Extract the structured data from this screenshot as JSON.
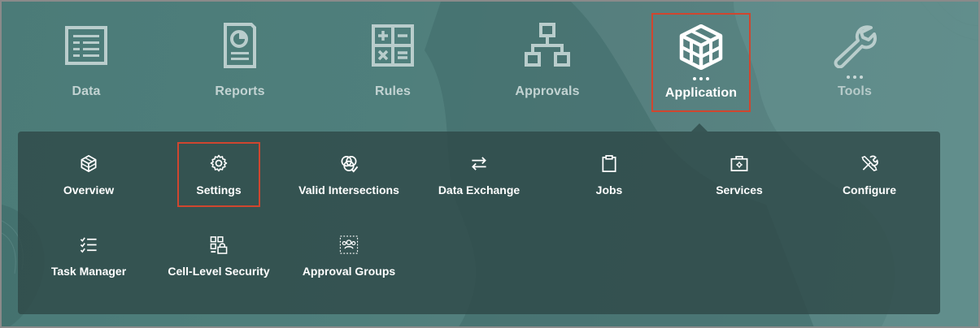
{
  "topnav": {
    "items": [
      {
        "label": "Data",
        "icon": "data-table-icon"
      },
      {
        "label": "Reports",
        "icon": "report-document-icon"
      },
      {
        "label": "Rules",
        "icon": "calculator-icon"
      },
      {
        "label": "Approvals",
        "icon": "hierarchy-icon"
      },
      {
        "label": "Application",
        "icon": "application-cube-icon",
        "active": true
      },
      {
        "label": "Tools",
        "icon": "wrench-icon"
      }
    ]
  },
  "submenu": {
    "items": [
      {
        "label": "Overview",
        "icon": "cube-icon"
      },
      {
        "label": "Settings",
        "icon": "gear-icon",
        "selected": true
      },
      {
        "label": "Valid Intersections",
        "icon": "intersect-circles-icon"
      },
      {
        "label": "Data Exchange",
        "icon": "exchange-arrows-icon"
      },
      {
        "label": "Jobs",
        "icon": "clipboard-icon"
      },
      {
        "label": "Services",
        "icon": "service-kit-icon"
      },
      {
        "label": "Configure",
        "icon": "tools-crossed-icon"
      },
      {
        "label": "Task Manager",
        "icon": "checklist-icon"
      },
      {
        "label": "Cell-Level Security",
        "icon": "cell-lock-icon"
      },
      {
        "label": "Approval Groups",
        "icon": "group-users-icon"
      }
    ]
  },
  "colors": {
    "highlight": "#d0462f",
    "background": "#4b7b78",
    "panel": "#2e4847"
  }
}
